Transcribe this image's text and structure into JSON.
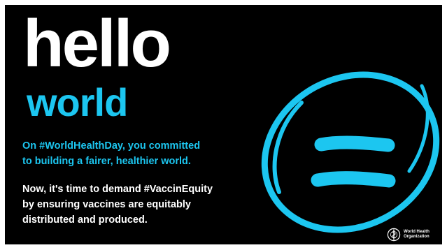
{
  "headline": {
    "hello": "hello",
    "world": "world"
  },
  "body": {
    "committed_line_1": "On #WorldHealthDay, you committed",
    "committed_line_2": "to building a fairer, healthier world.",
    "demand_line_1": "Now, it's time to demand #VaccinEquity",
    "demand_line_2": "by ensuring vaccines are equitably",
    "demand_line_3": "distributed and produced."
  },
  "emblem": {
    "icon": "equals-sign-in-circle-icon"
  },
  "logo": {
    "icon": "who-emblem-icon",
    "name_line_1": "World Health",
    "name_line_2": "Organization"
  },
  "colors": {
    "background": "#000000",
    "accent": "#1cc6f0",
    "text": "#ffffff"
  }
}
